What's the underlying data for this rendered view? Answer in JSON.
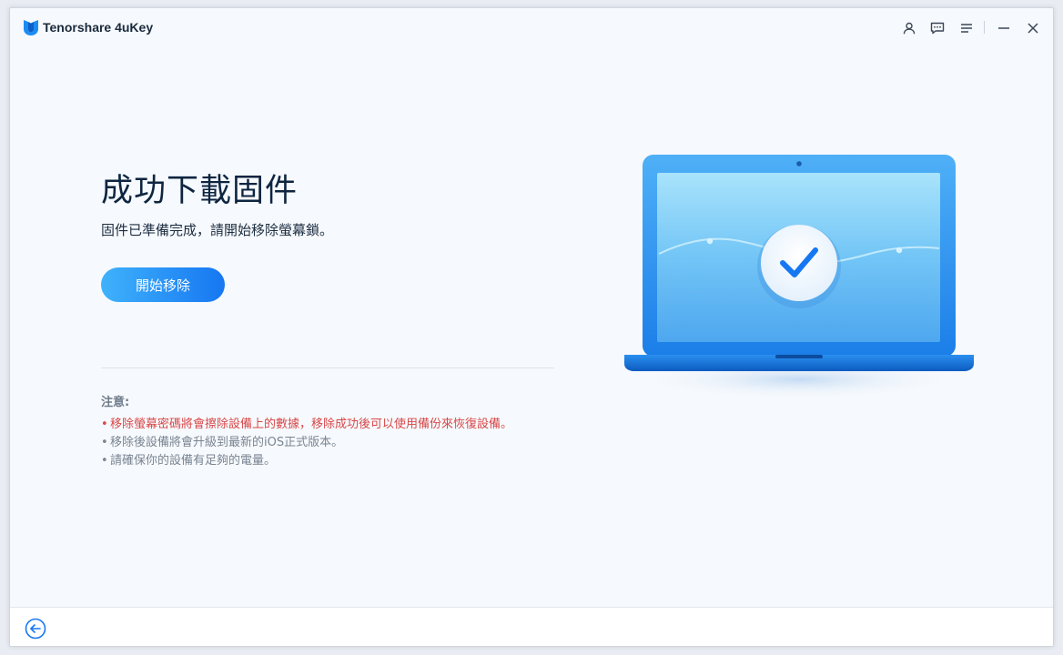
{
  "app": {
    "title": "Tenorshare 4uKey",
    "brand_color": "#1677f2"
  },
  "titlebar": {
    "icons": [
      "user-icon",
      "feedback-icon",
      "menu-icon",
      "minimize-icon",
      "close-icon"
    ]
  },
  "main": {
    "title": "成功下載固件",
    "subtitle": "固件已準備完成，請開始移除螢幕鎖。",
    "start_button": "開始移除",
    "notice_label": "注意:",
    "notes": [
      "移除螢幕密碼將會擦除設備上的數據，移除成功後可以使用備份來恢復設備。",
      "移除後設備將會升級到最新的iOS正式版本。",
      "請確保你的設備有足夠的電量。"
    ],
    "bullet": "•",
    "warning_color": "#d94848"
  },
  "footer": {
    "back_icon": "back-arrow-icon"
  }
}
